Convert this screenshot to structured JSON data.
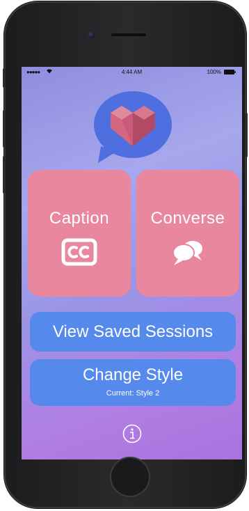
{
  "status_bar": {
    "signal": "●●●●●",
    "time": "4:44 AM",
    "battery": "100%"
  },
  "app": {
    "logo_icon": "heart-speech-bubble-icon",
    "tiles": [
      {
        "label": "Caption",
        "icon": "closed-caption-icon"
      },
      {
        "label": "Converse",
        "icon": "chat-bubbles-icon"
      }
    ],
    "view_saved_label": "View Saved Sessions",
    "change_style_label": "Change Style",
    "current_style": "Current: Style 2",
    "info_icon": "info-icon"
  },
  "colors": {
    "tile": "#e8879d",
    "button": "#5589ec",
    "logo_bubble": "#4f6fe0",
    "heart": "#c95a7a"
  }
}
